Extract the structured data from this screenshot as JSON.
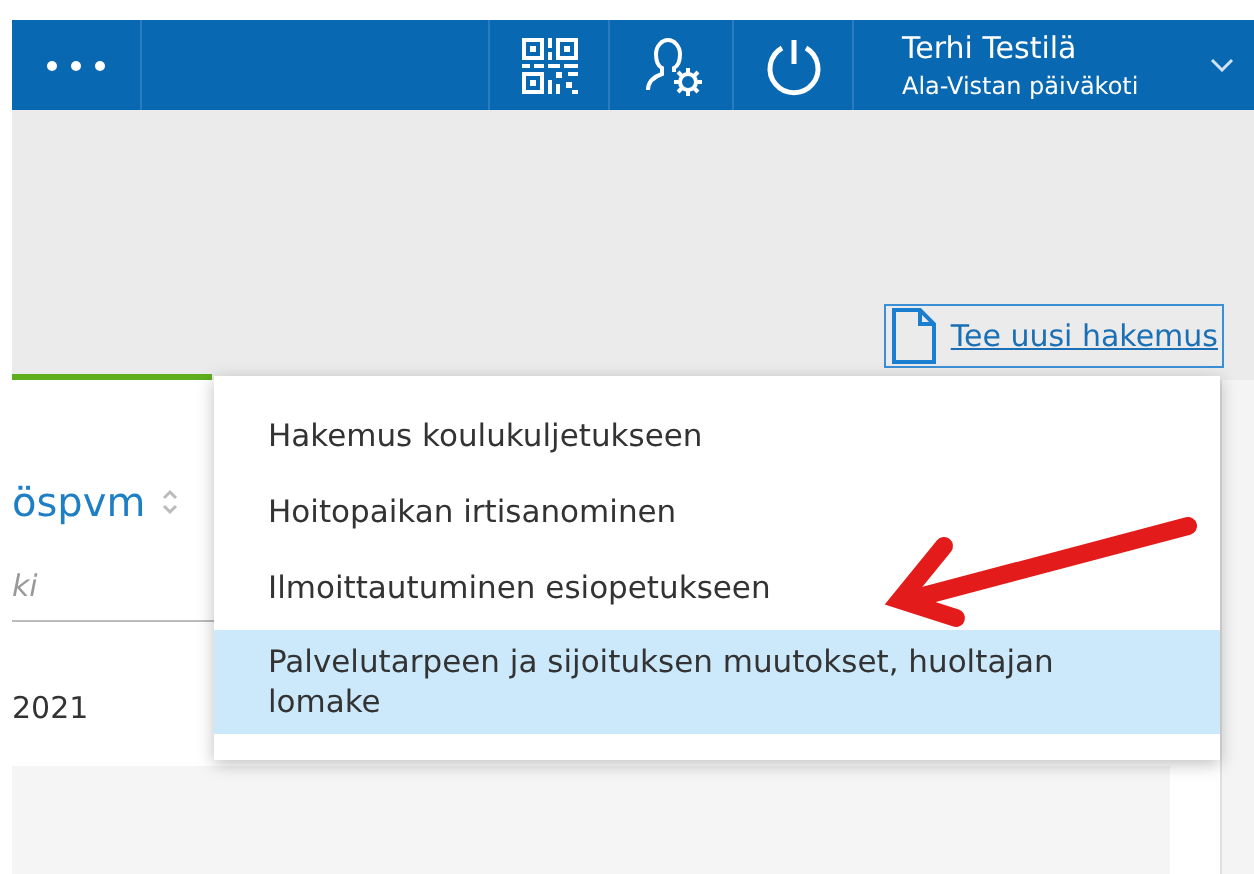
{
  "header": {
    "user_name": "Terhi Testilä",
    "unit": "Ala-Vistan päiväkoti"
  },
  "new_application_link": "Tee uusi hakemus",
  "table": {
    "column_header": "öspvm",
    "filter": {
      "placeholder": "ki"
    },
    "cell": "2021"
  },
  "menu": {
    "items": [
      {
        "label": "Hakemus koulukuljetukseen",
        "selected": false
      },
      {
        "label": "Hoitopaikan irtisanominen",
        "selected": false
      },
      {
        "label": "Ilmoittautuminen esiopetukseen",
        "selected": false
      },
      {
        "label": "Palvelutarpeen ja sijoituksen muutokset, huoltajan lomake",
        "selected": true
      }
    ]
  }
}
